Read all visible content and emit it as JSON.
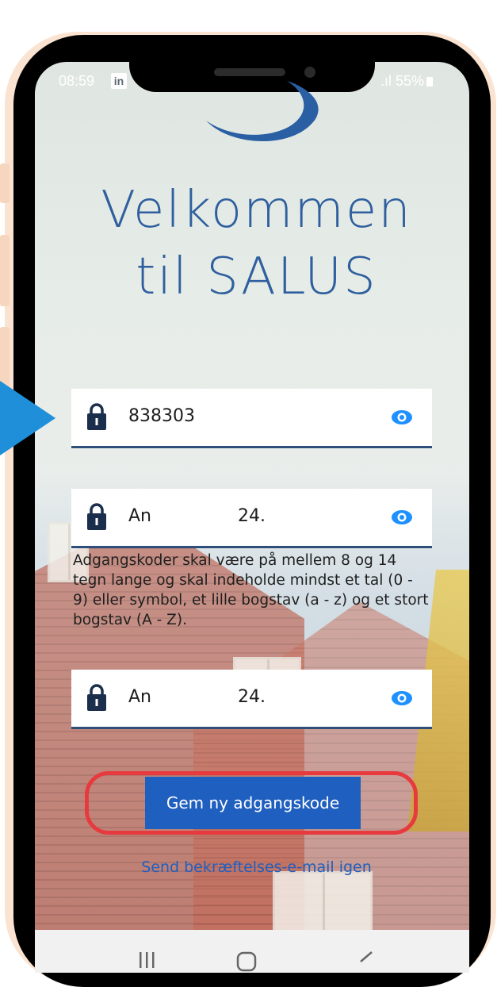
{
  "status_bar": {
    "time": "08:59",
    "app_icon_letter": "in",
    "signal_battery": ".ıl 55%"
  },
  "header": {
    "title_line1": "Velkommen",
    "title_line2": "til SALUS"
  },
  "form": {
    "field1_value": "838303",
    "field2_value_start": "An",
    "field2_value_end": "24.",
    "password_hint": "Adgangskoder skal være på mellem 8 og 14 tegn lange og skal indeholde mindst et tal (0 - 9) eller symbol, et lille bogstav (a - z) og et stort bogstav (A - Z).",
    "field3_value_start": "An",
    "field3_value_end": "24.",
    "save_label": "Gem ny adgangskode",
    "resend_label": "Send bekræftelses-e-mail igen"
  },
  "colors": {
    "accent": "#1f5fbf",
    "title": "#2f5f9e",
    "highlight": "#e63a3f",
    "pointer": "#1e8fd8"
  },
  "icons": {
    "lock": "lock-icon",
    "eye": "eye-icon"
  }
}
